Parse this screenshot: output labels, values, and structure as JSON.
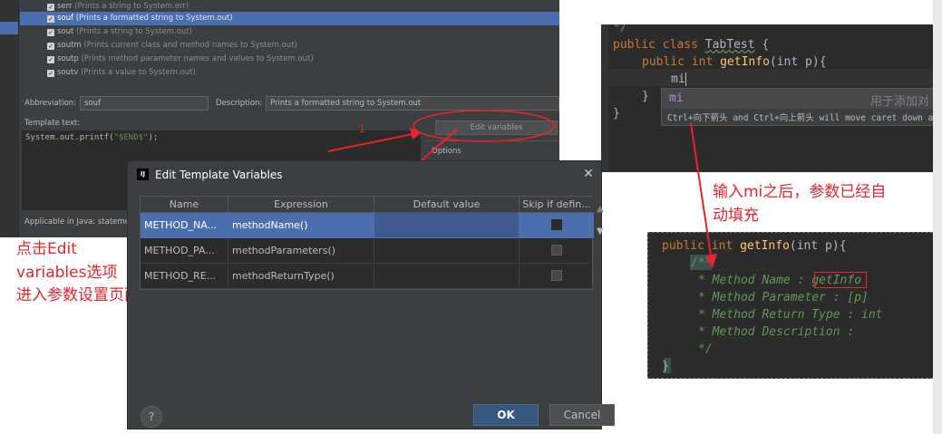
{
  "settings": {
    "templates": [
      {
        "abbr": "serr",
        "desc": "(Prints a string to System.err)",
        "checked": true,
        "selected": false
      },
      {
        "abbr": "souf",
        "desc": "(Prints a formatted string to System.out)",
        "checked": true,
        "selected": true
      },
      {
        "abbr": "sout",
        "desc": "(Prints a string to System.out)",
        "checked": true,
        "selected": false
      },
      {
        "abbr": "soutm",
        "desc": "(Prints current class and method names to System.out)",
        "checked": true,
        "selected": false
      },
      {
        "abbr": "soutp",
        "desc": "(Prints method parameter names and values to System.out)",
        "checked": true,
        "selected": false
      },
      {
        "abbr": "soutv",
        "desc": "(Prints a value to System.out)",
        "checked": true,
        "selected": false
      }
    ],
    "abbreviation_label": "Abbreviation:",
    "abbreviation_value": "souf",
    "description_label": "Description:",
    "description_value": "Prints a formatted string to System.out",
    "template_text_label": "Template text:",
    "template_text_prefix": "System.out.printf(",
    "template_text_string": "\"$END$\"",
    "template_text_suffix": ");",
    "edit_variables_label": "Edit variables",
    "options_label": "Options",
    "applicable_label": "Applicable in Java: statemer"
  },
  "annotations": {
    "left_lines": [
      "点击Edit",
      "variables选项",
      "进入参数设置页面"
    ],
    "right_lines": [
      "输入mi之后，参数已经自",
      "动填充"
    ],
    "step_number": "1"
  },
  "dialog": {
    "title": "Edit Template Variables",
    "icon_text": "IJ",
    "columns": [
      "Name",
      "Expression",
      "Default value",
      "Skip if defin..."
    ],
    "rows": [
      {
        "name": "METHOD_NA...",
        "expression": "methodName()",
        "default": "",
        "skip": false,
        "selected": true
      },
      {
        "name": "METHOD_PA...",
        "expression": "methodParameters()",
        "default": "",
        "skip": false,
        "selected": false
      },
      {
        "name": "METHOD_RE...",
        "expression": "methodReturnType()",
        "default": "",
        "skip": false,
        "selected": false
      }
    ],
    "help_label": "?",
    "ok_label": "OK",
    "cancel_label": "Cancel",
    "close_glyph": "✕"
  },
  "editor_top": {
    "line_comment": "*/",
    "l2_kw1": "public",
    "l2_kw2": "class",
    "l2_name": "TabTest",
    "l2_brace": "{",
    "l3_kw1": "public",
    "l3_type": "int",
    "l3_fn": "getInfo",
    "l3_params": "(int p){",
    "l4_typed": "mi",
    "l5_brace": "}",
    "l6_brace": "}",
    "popup_item": "mi",
    "popup_hint": "用于添加对",
    "popup_footer": "Ctrl+向下箭头 and Ctrl+向上箭头 will move caret down and up i"
  },
  "editor_bottom": {
    "l1_kw1": "public",
    "l1_type": "int",
    "l1_fn": "getInfo",
    "l1_params": "(int p){",
    "doc_lines": [
      {
        "prefix": "/**",
        "value": ""
      },
      {
        "prefix": "* Method Name : ",
        "value": "getInfo"
      },
      {
        "prefix": "* Method Parameter : ",
        "value": "[p]"
      },
      {
        "prefix": "* Method Return Type : ",
        "value": "int"
      },
      {
        "prefix": "* Method Description : ",
        "value": ""
      },
      {
        "prefix": "*/",
        "value": ""
      }
    ],
    "closing_brace": "}"
  },
  "colors": {
    "annotation_red": "#e8232c",
    "selection_blue": "#4b6eaf",
    "ok_button": "#365880",
    "darcula_bg": "#2b2b2b"
  }
}
